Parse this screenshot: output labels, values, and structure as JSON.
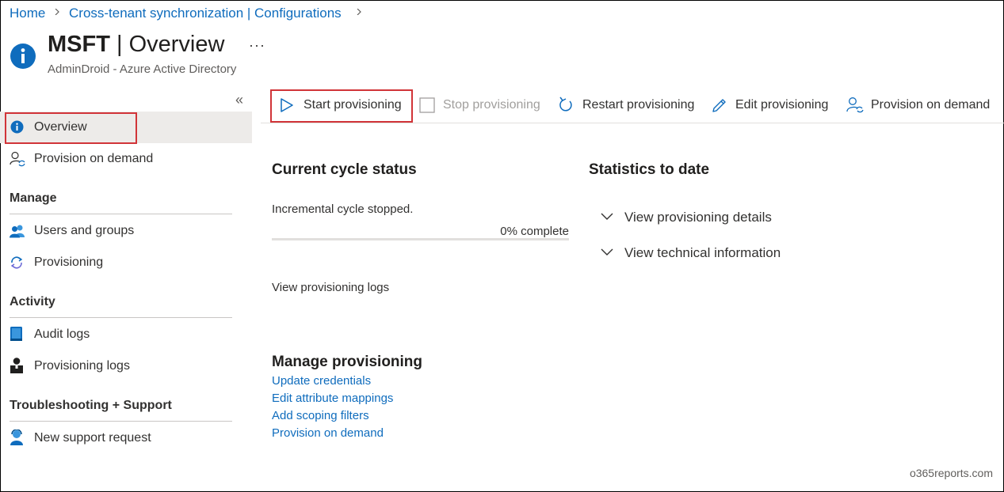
{
  "breadcrumb": {
    "home": "Home",
    "parent": "Cross-tenant synchronization | Configurations"
  },
  "header": {
    "title_bold": "MSFT",
    "title_rest": " | Overview",
    "more": "···",
    "subtitle": "AdminDroid - Azure Active Directory"
  },
  "sidebar": {
    "collapse": "«",
    "overview": "Overview",
    "provision_on_demand": "Provision on demand",
    "manage_heading": "Manage",
    "users_groups": "Users and groups",
    "provisioning": "Provisioning",
    "activity_heading": "Activity",
    "audit_logs": "Audit logs",
    "provisioning_logs": "Provisioning logs",
    "support_heading": "Troubleshooting + Support",
    "new_support_request": "New support request"
  },
  "toolbar": {
    "start": "Start provisioning",
    "stop": "Stop provisioning",
    "restart": "Restart provisioning",
    "edit": "Edit provisioning",
    "on_demand": "Provision on demand"
  },
  "cycle": {
    "heading": "Current cycle status",
    "status": "Incremental cycle stopped.",
    "percent_label": "0% complete",
    "progress_fraction": 0,
    "logs_link": "View provisioning logs"
  },
  "stats": {
    "heading": "Statistics to date",
    "details": "View provisioning details",
    "technical": "View technical information"
  },
  "manage_provisioning": {
    "heading": "Manage provisioning",
    "links": [
      "Update credentials",
      "Edit attribute mappings",
      "Add scoping filters",
      "Provision on demand"
    ]
  },
  "watermark": "o365reports.com",
  "colors": {
    "accent": "#0f6cbd",
    "highlight": "#d13438",
    "selected_bg": "#edebe9"
  }
}
